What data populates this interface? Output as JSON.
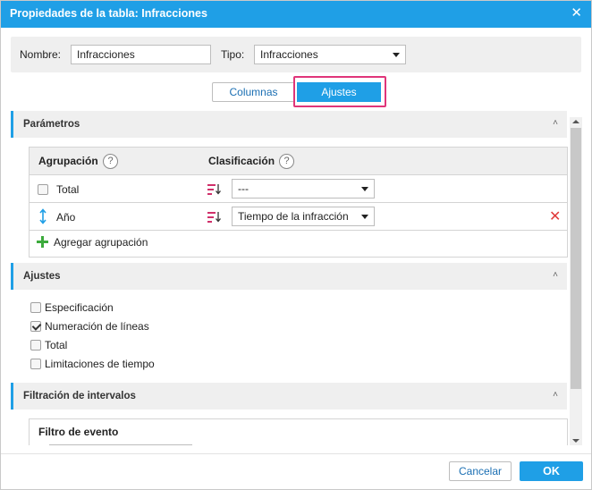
{
  "dialog": {
    "title": "Propiedades de la tabla: Infracciones",
    "close_icon": "close-icon"
  },
  "form": {
    "name_label": "Nombre:",
    "name_value": "Infracciones",
    "type_label": "Tipo:",
    "type_value": "Infracciones"
  },
  "tabs": [
    {
      "label": "Columnas",
      "active": false
    },
    {
      "label": "Ajustes",
      "active": true
    }
  ],
  "parametros": {
    "title": "Parámetros",
    "col_grouping": "Agrupación",
    "col_sorting": "Clasificación",
    "help": "?",
    "rows": [
      {
        "label": "Total",
        "sort": "---",
        "checked": false
      },
      {
        "label": "Año",
        "sort": "Tiempo de la infracción"
      }
    ],
    "add_label": "Agregar agrupación"
  },
  "ajustes": {
    "title": "Ajustes",
    "options": [
      {
        "label": "Especificación",
        "checked": false
      },
      {
        "label": "Numeración de líneas",
        "checked": true
      },
      {
        "label": "Total",
        "checked": false
      },
      {
        "label": "Limitaciones de tiempo",
        "checked": false
      }
    ]
  },
  "filtracion": {
    "title": "Filtración de intervalos",
    "event_filter": "Filtro de evento"
  },
  "footer": {
    "cancel": "Cancelar",
    "ok": "OK"
  },
  "colors": {
    "accent": "#1f9fe6",
    "highlight": "#e0357a",
    "remove": "#e03a3a",
    "add": "#3caa3c"
  }
}
